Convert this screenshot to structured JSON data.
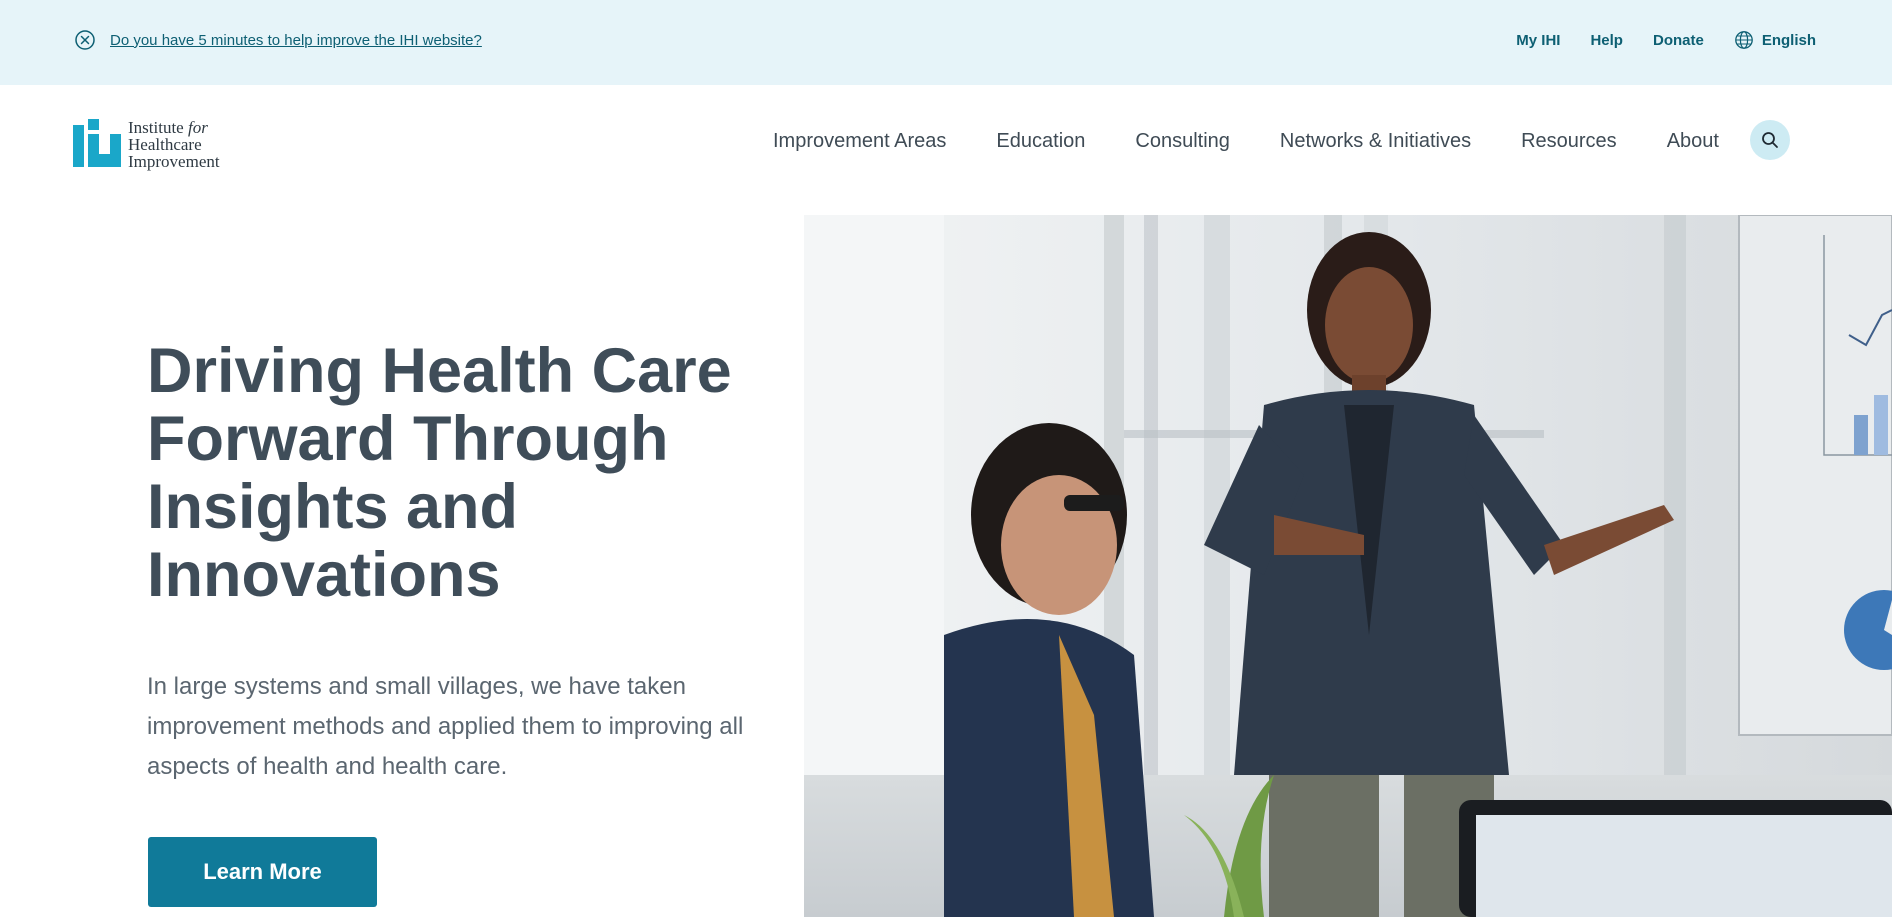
{
  "survey": {
    "text": "Do you have 5 minutes to help improve the IHI website?"
  },
  "utility_nav": {
    "my_ihi": "My IHI",
    "help": "Help",
    "donate": "Donate",
    "language": "English"
  },
  "logo": {
    "line1": "Institute",
    "line1_italic": "for",
    "line2": "Healthcare",
    "line3": "Improvement"
  },
  "main_nav": {
    "items": [
      {
        "label": "Improvement Areas"
      },
      {
        "label": "Education"
      },
      {
        "label": "Consulting"
      },
      {
        "label": "Networks & Initiatives"
      },
      {
        "label": "Resources"
      },
      {
        "label": "About"
      }
    ]
  },
  "hero": {
    "title": "Driving Health Care Forward Through Insights and Innovations",
    "text": "In large systems and small villages, we have taken improvement methods and applied them to improving all aspects of health and health care.",
    "cta": "Learn More"
  },
  "icons": {
    "close": "close-circle-icon",
    "globe": "globe-icon",
    "search": "search-icon"
  },
  "colors": {
    "banner_bg": "#e6f4f9",
    "brand_teal": "#107a99",
    "logo_cyan": "#1aa7c9",
    "link_teal": "#0d5f73",
    "heading": "#3f4d59"
  }
}
